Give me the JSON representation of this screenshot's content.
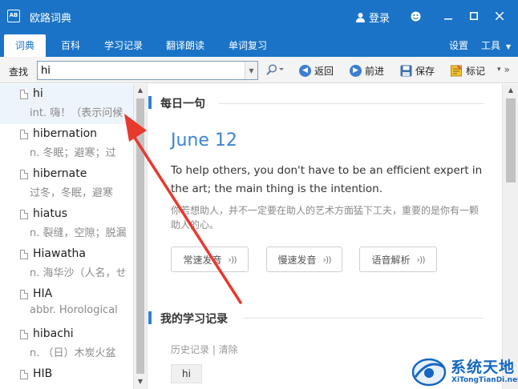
{
  "window": {
    "app_icon_text": "AB",
    "title": "欧路词典",
    "login_label": "登录",
    "controls": [
      "smiley",
      "minimize",
      "maximize",
      "close"
    ]
  },
  "menu": {
    "tabs": [
      {
        "label": "词典",
        "active": true
      },
      {
        "label": "百科"
      },
      {
        "label": "学习记录"
      },
      {
        "label": "翻译朗读"
      },
      {
        "label": "单词复习"
      }
    ],
    "settings_label": "设置",
    "tools_label": "工具",
    "tools_caret": "▼"
  },
  "toolbar": {
    "search_label": "查找",
    "search_value": "hi",
    "back_label": "返回",
    "forward_label": "前进",
    "save_label": "保存",
    "mark_label": "标记",
    "more_caret": "▾",
    "more_arrows": "»"
  },
  "word_list": [
    {
      "word": "hi",
      "def": "int. 嗨！（表示问候"
    },
    {
      "word": "hibernation",
      "def": "n. 冬眠；避寒；过"
    },
    {
      "word": "hibernate",
      "def": "过冬，冬眠，避寒"
    },
    {
      "word": "hiatus",
      "def": "n. 裂缝，空隙；脱漏"
    },
    {
      "word": "Hiawatha",
      "def": "n. 海华沙（人名，せ"
    },
    {
      "word": "HIA",
      "def": "abbr. Horological"
    },
    {
      "word": "hibachi",
      "def": "n. （日）木炭火盆"
    },
    {
      "word": "HIB",
      "def": ""
    }
  ],
  "daily": {
    "section_title": "每日一句",
    "date": "June 12",
    "english": "To help others, you don't have to be an efficient expert in the art; the main thing is the intention.",
    "chinese": "你若想助人，并不一定要在助人的艺术方面猛下工夫，重要的是你有一颗助人的心。",
    "buttons": [
      "常速发音",
      "慢速发音",
      "语音解析"
    ]
  },
  "study": {
    "section_title": "我的学习记录",
    "history_label": "历史记录 | 清除",
    "history_items": [
      "hi"
    ]
  },
  "watermark": {
    "title": "系统天地",
    "subtitle": "XiTongTianDi.net"
  },
  "colors": {
    "titlebar": "#1a73c7",
    "accent": "#2f7fd6",
    "annotation_arrow": "#e8392f"
  }
}
